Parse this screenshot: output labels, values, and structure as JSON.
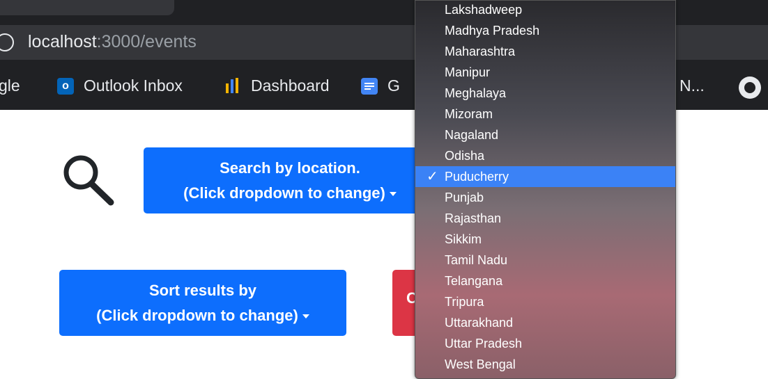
{
  "browser": {
    "url_host": "localhost",
    "url_path": ":3000/events",
    "bookmarks": [
      {
        "label": "gle"
      },
      {
        "label": "Outlook Inbox"
      },
      {
        "label": "Dashboard"
      },
      {
        "label": "G"
      },
      {
        "label": "N..."
      }
    ]
  },
  "page": {
    "search_button": {
      "line1": "Search by location.",
      "line2": "(Click dropdown to change)"
    },
    "sort_button": {
      "line1": "Sort results by",
      "line2": "(Click dropdown to change)"
    },
    "red_button_label": "C"
  },
  "dropdown": {
    "items": [
      "Lakshadweep",
      "Madhya Pradesh",
      "Maharashtra",
      "Manipur",
      "Meghalaya",
      "Mizoram",
      "Nagaland",
      "Odisha",
      "Puducherry",
      "Punjab",
      "Rajasthan",
      "Sikkim",
      "Tamil Nadu",
      "Telangana",
      "Tripura",
      "Uttarakhand",
      "Uttar Pradesh",
      "West Bengal"
    ],
    "selected": "Puducherry",
    "check_glyph": "✓"
  },
  "colors": {
    "primary": "#0d6efd",
    "danger": "#dc3545",
    "selected_item": "#3b82f6"
  }
}
